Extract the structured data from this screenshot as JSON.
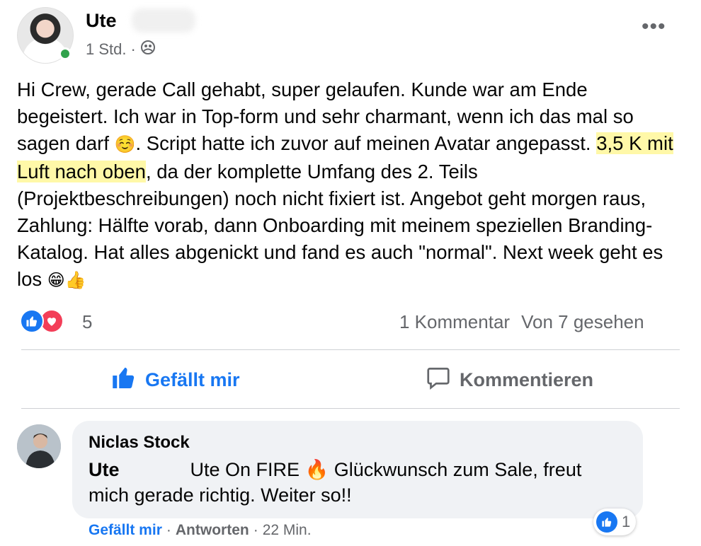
{
  "post": {
    "author": "Ute",
    "time": "1 Std.",
    "separator": "·",
    "privacy_icon": "group-icon",
    "more_icon": "more-options-icon",
    "text_before": "Hi Crew, gerade Call gehabt, super gelaufen. Kunde war am Ende begeistert. Ich war in Top-form und sehr charmant, wenn ich das mal so sagen darf ",
    "emoji_smile": "☺️",
    "text_mid": ". Script hatte ich zuvor auf meinen Avatar angepasst. ",
    "highlight": "3,5 K mit Luft nach oben",
    "text_after": ", da der komplette Umfang des 2. Teils (Projektbeschreibungen) noch nicht fixiert ist. Angebot geht morgen raus, Zahlung: Hälfte vorab, dann Onboarding mit meinem speziellen Branding-Katalog. Hat alles abgenickt und fand es auch \"normal\". Next week geht es los ",
    "emoji_end": "😁👍",
    "highlight_color": "#fff8a8"
  },
  "reactions": {
    "count": "5",
    "types": [
      "like",
      "love"
    ]
  },
  "stats": {
    "comments": "1 Kommentar",
    "seen": "Von 7 gesehen"
  },
  "actions": {
    "like": "Gefällt mir",
    "comment": "Kommentieren"
  },
  "comment": {
    "author": "Niclas Stock",
    "mention": "Ute",
    "text_a": "Ute On FIRE ",
    "emoji_fire": "🔥",
    "text_b": " Glückwunsch zum Sale, freut mich gerade richtig. Weiter so!!",
    "reaction_count": "1",
    "like_label": "Gefällt mir",
    "dot1": "·",
    "reply_label": "Antworten",
    "dot2": "·",
    "time": "22 Min."
  },
  "colors": {
    "facebook_blue": "#1877f2",
    "love_red": "#f33e58",
    "online_green": "#31a24c",
    "secondary_text": "#65676b"
  }
}
